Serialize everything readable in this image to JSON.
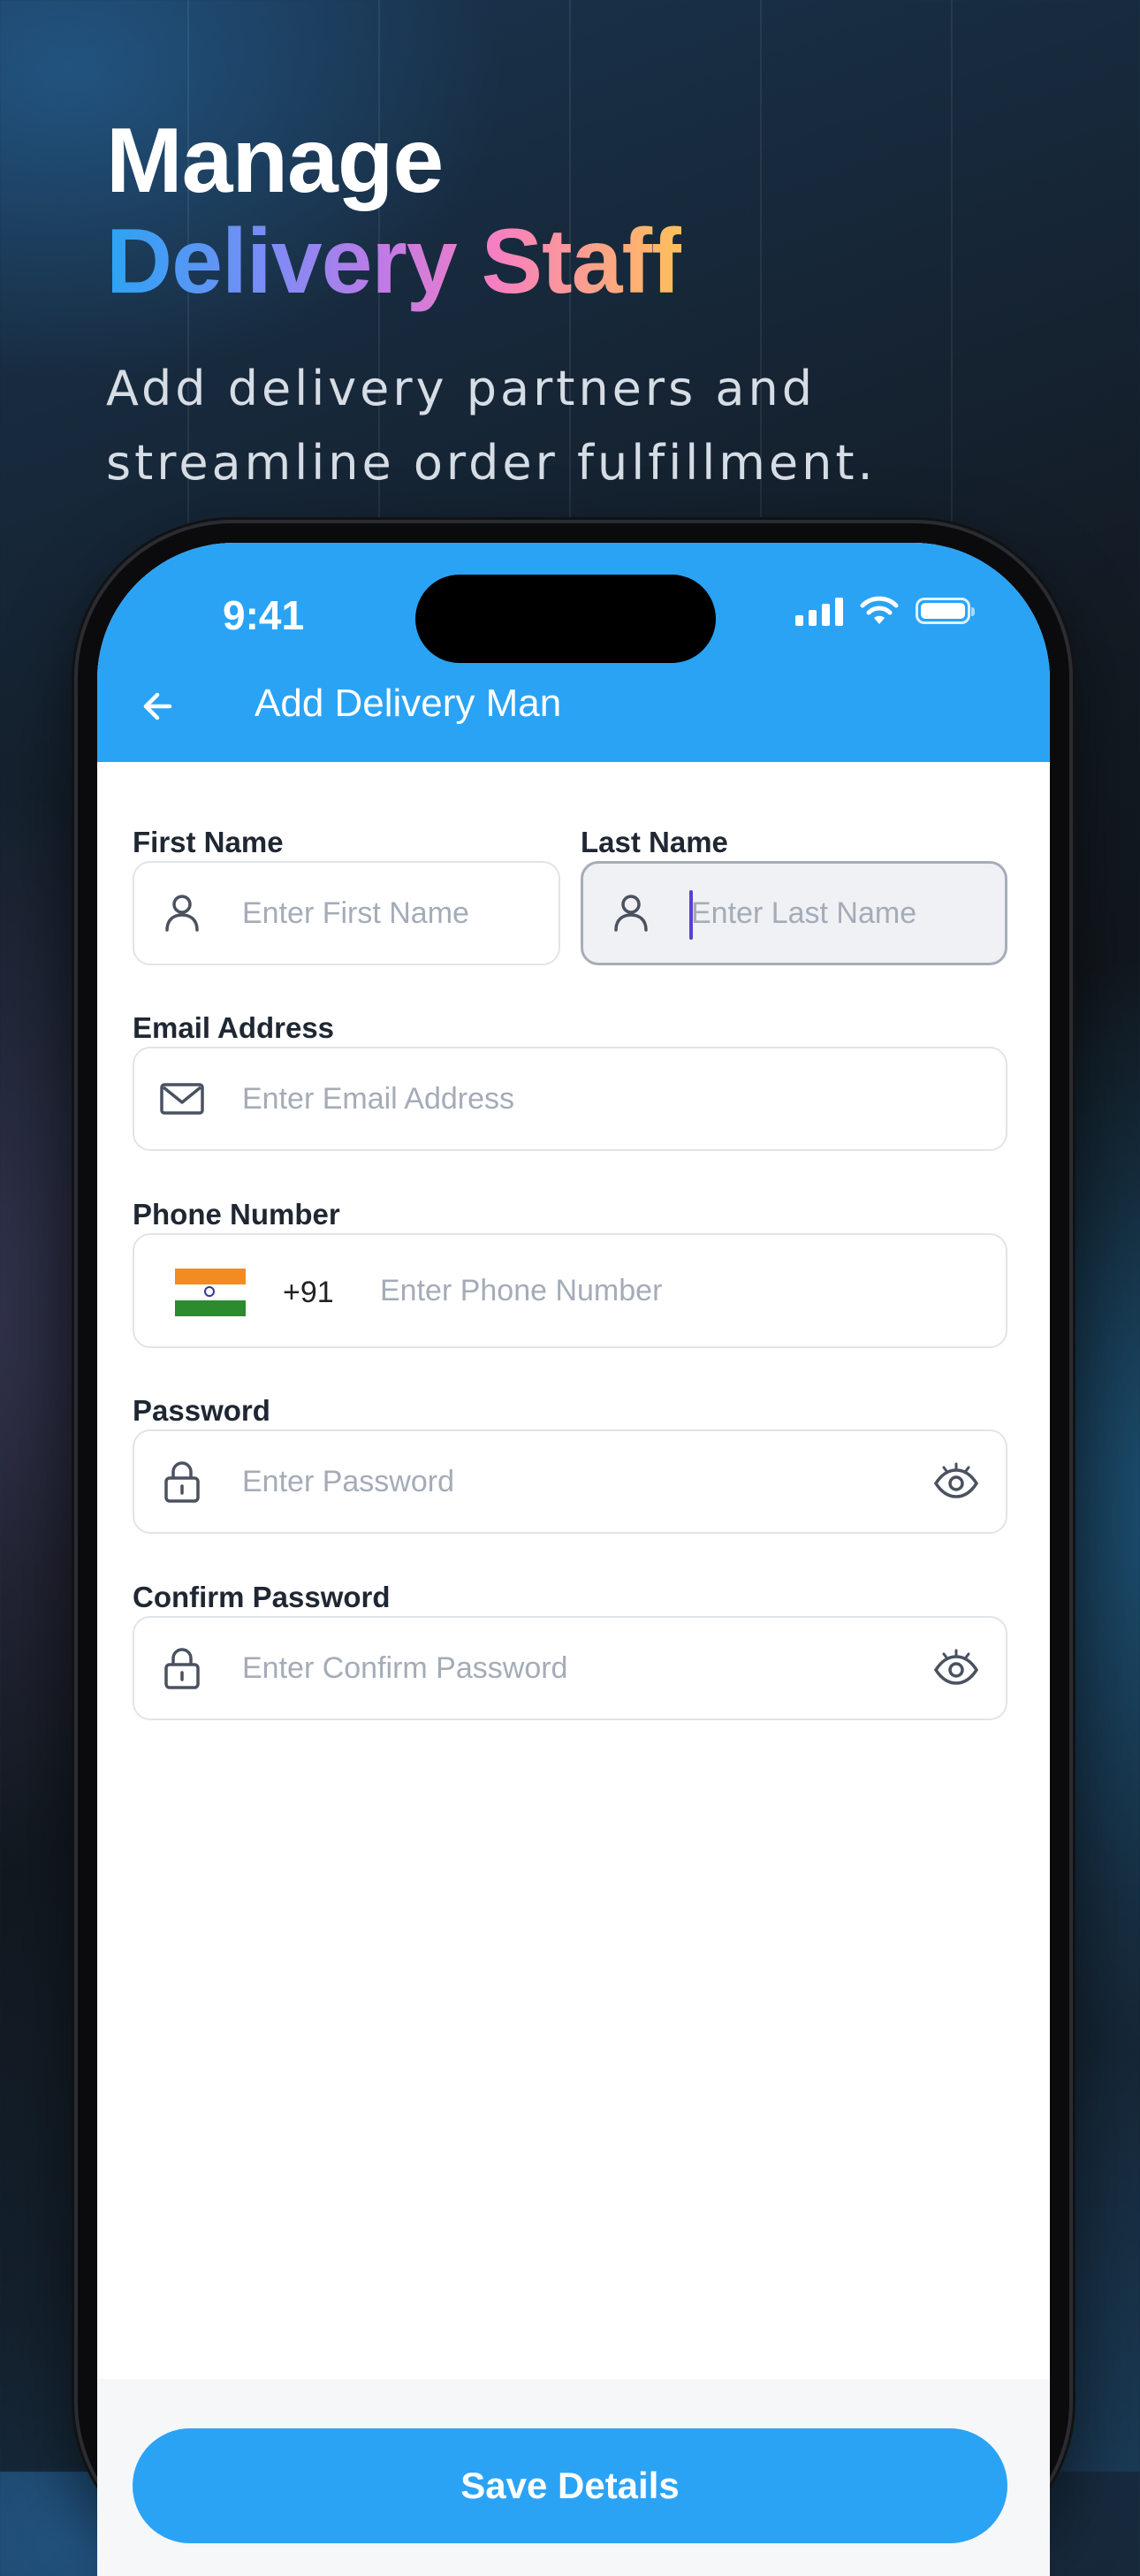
{
  "promo": {
    "title_line1": "Manage",
    "title_line2": "Delivery Staff",
    "subtitle": "Add delivery partners and streamline order fulfillment."
  },
  "status_bar": {
    "time": "9:41"
  },
  "header": {
    "title": "Add Delivery Man"
  },
  "form": {
    "first_name": {
      "label": "First Name",
      "placeholder": "Enter First Name"
    },
    "last_name": {
      "label": "Last Name",
      "placeholder": "Enter Last Name"
    },
    "email": {
      "label": "Email Address",
      "placeholder": "Enter Email Address"
    },
    "phone": {
      "label": "Phone Number",
      "country_code": "+91",
      "placeholder": "Enter Phone Number"
    },
    "password": {
      "label": "Password",
      "placeholder": "Enter Password"
    },
    "confirm_password": {
      "label": "Confirm Password",
      "placeholder": "Enter Confirm Password"
    }
  },
  "save_button": "Save Details",
  "colors": {
    "primary": "#2aa3f5",
    "gradient": [
      "#2aa4f4",
      "#c07ae6",
      "#f77fc0",
      "#ffc05a"
    ]
  },
  "icons": [
    "back-arrow-icon",
    "person-icon",
    "mail-icon",
    "india-flag-icon",
    "lock-icon",
    "eye-icon",
    "signal-icon",
    "wifi-icon",
    "battery-icon"
  ]
}
